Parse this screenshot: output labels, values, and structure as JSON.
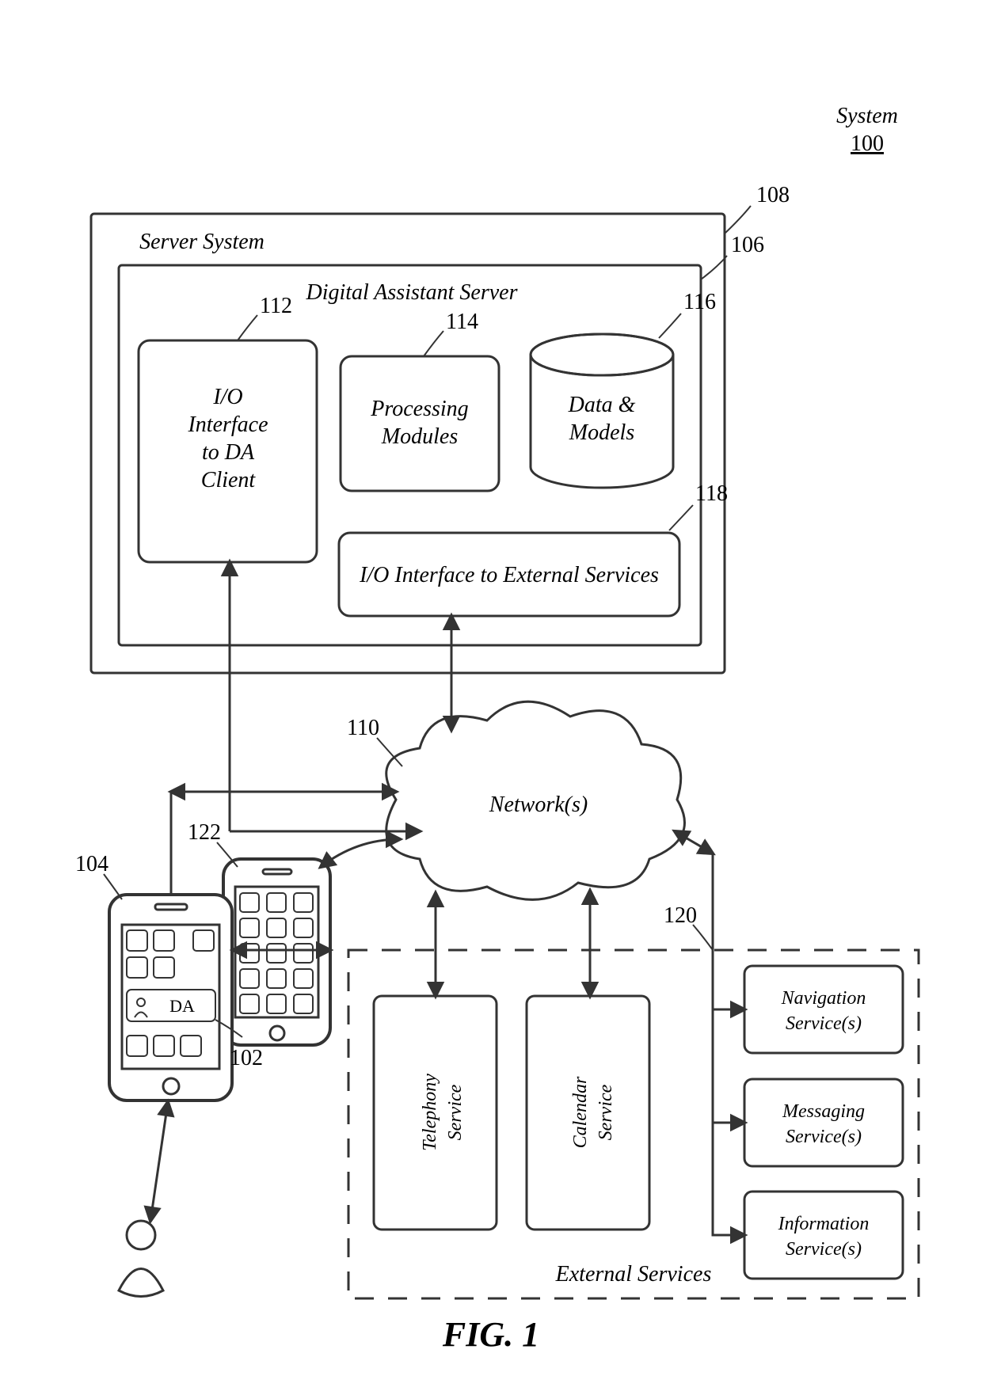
{
  "figure": {
    "caption": "FIG. 1"
  },
  "system": {
    "label": "System",
    "id": "100"
  },
  "server_system": {
    "label": "Server System",
    "ref": "108"
  },
  "da_server": {
    "label": "Digital Assistant Server",
    "ref": "106"
  },
  "io_client": {
    "line1": "I/O",
    "line2": "Interface",
    "line3": "to DA",
    "line4": "Client",
    "ref": "112"
  },
  "processing": {
    "line1": "Processing",
    "line2": "Modules",
    "ref": "114"
  },
  "data_models": {
    "line1": "Data &",
    "line2": "Models",
    "ref": "116"
  },
  "io_ext": {
    "label": "I/O Interface to External Services",
    "ref": "118"
  },
  "network": {
    "label": "Network(s)",
    "ref": "110"
  },
  "external": {
    "label": "External Services",
    "ref": "120"
  },
  "services": {
    "telephony": {
      "line1": "Telephony",
      "line2": "Service"
    },
    "calendar": {
      "line1": "Calendar",
      "line2": "Service"
    },
    "navigation": {
      "line1": "Navigation",
      "line2": "Service(s)"
    },
    "messaging": {
      "line1": "Messaging",
      "line2": "Service(s)"
    },
    "information": {
      "line1": "Information",
      "line2": "Service(s)"
    }
  },
  "devices": {
    "da_label": "DA",
    "phone1_ref": "104",
    "phone1_inner_ref": "102",
    "phone2_ref": "122"
  }
}
